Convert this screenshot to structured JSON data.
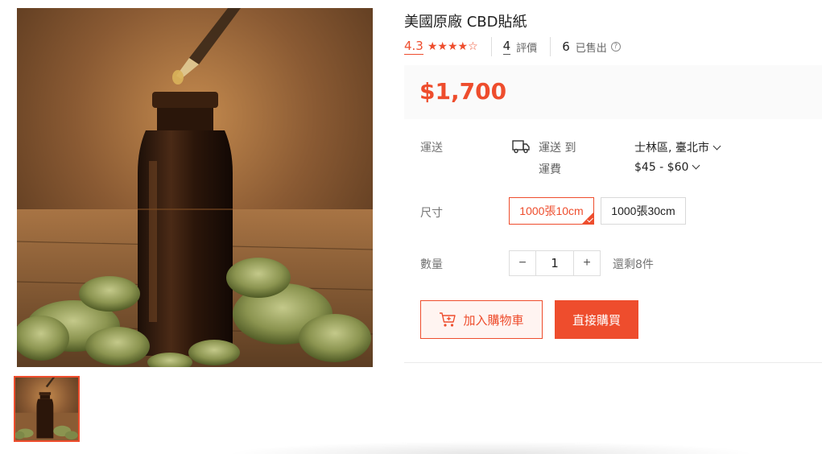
{
  "product": {
    "title": "美國原廠 CBD貼紙",
    "rating": "4.3",
    "stars": "★★★★☆",
    "review_count": "4",
    "review_label": "評價",
    "sold_count": "6",
    "sold_label": "已售出",
    "help_icon": "?",
    "price": "$1,700"
  },
  "shipping": {
    "label": "運送",
    "icon": "truck-icon",
    "to_label": "運送 到",
    "location": "士林區, 臺北市",
    "fee_label": "運費",
    "fee": "$45 - $60"
  },
  "variations": {
    "label": "尺寸",
    "options": [
      "1000張10cm",
      "1000張30cm"
    ],
    "selected": "1000張10cm"
  },
  "quantity": {
    "label": "數量",
    "minus": "−",
    "value": "1",
    "plus": "+",
    "stock": "還剩8件"
  },
  "actions": {
    "add_to_cart": "加入購物車",
    "buy_now": "直接購買"
  },
  "colors": {
    "accent": "#ee4d2d",
    "price_bg": "#fafafa",
    "cart_bg": "#fff4f1"
  }
}
